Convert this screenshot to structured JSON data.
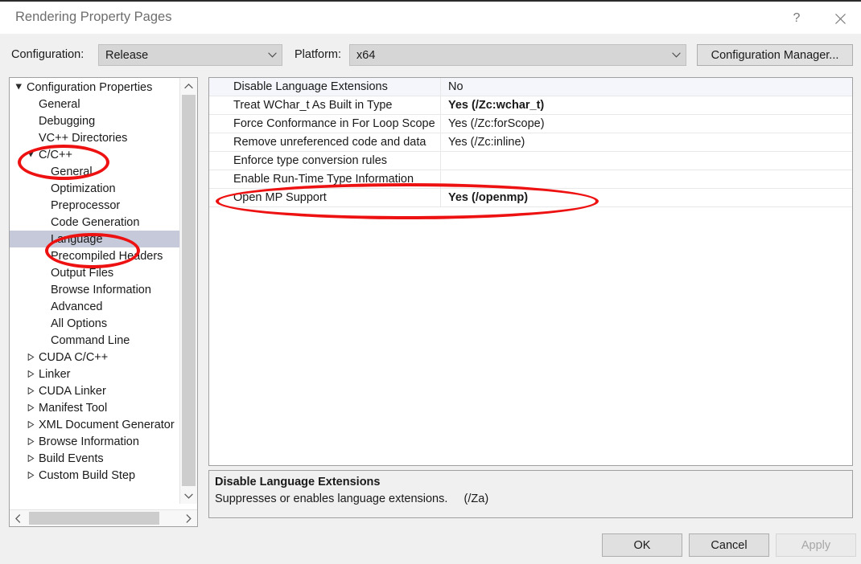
{
  "window": {
    "title": "Rendering Property Pages",
    "help_label": "?",
    "close_label": "Close"
  },
  "toolbar": {
    "configuration_label": "Configuration:",
    "configuration_value": "Release",
    "platform_label": "Platform:",
    "platform_value": "x64",
    "configuration_manager_label": "Configuration Manager..."
  },
  "tree": {
    "nodes": [
      {
        "label": "Configuration Properties",
        "level": 0,
        "state": "expanded",
        "selected": false
      },
      {
        "label": "General",
        "level": 1,
        "state": "leaf",
        "selected": false
      },
      {
        "label": "Debugging",
        "level": 1,
        "state": "leaf",
        "selected": false
      },
      {
        "label": "VC++ Directories",
        "level": 1,
        "state": "leaf",
        "selected": false
      },
      {
        "label": "C/C++",
        "level": 1,
        "state": "expanded",
        "selected": false
      },
      {
        "label": "General",
        "level": 2,
        "state": "leaf",
        "selected": false
      },
      {
        "label": "Optimization",
        "level": 2,
        "state": "leaf",
        "selected": false
      },
      {
        "label": "Preprocessor",
        "level": 2,
        "state": "leaf",
        "selected": false
      },
      {
        "label": "Code Generation",
        "level": 2,
        "state": "leaf",
        "selected": false
      },
      {
        "label": "Language",
        "level": 2,
        "state": "leaf",
        "selected": true
      },
      {
        "label": "Precompiled Headers",
        "level": 2,
        "state": "leaf",
        "selected": false
      },
      {
        "label": "Output Files",
        "level": 2,
        "state": "leaf",
        "selected": false
      },
      {
        "label": "Browse Information",
        "level": 2,
        "state": "leaf",
        "selected": false
      },
      {
        "label": "Advanced",
        "level": 2,
        "state": "leaf",
        "selected": false
      },
      {
        "label": "All Options",
        "level": 2,
        "state": "leaf",
        "selected": false
      },
      {
        "label": "Command Line",
        "level": 2,
        "state": "leaf",
        "selected": false
      },
      {
        "label": "CUDA C/C++",
        "level": 1,
        "state": "collapsed",
        "selected": false
      },
      {
        "label": "Linker",
        "level": 1,
        "state": "collapsed",
        "selected": false
      },
      {
        "label": "CUDA Linker",
        "level": 1,
        "state": "collapsed",
        "selected": false
      },
      {
        "label": "Manifest Tool",
        "level": 1,
        "state": "collapsed",
        "selected": false
      },
      {
        "label": "XML Document Generator",
        "level": 1,
        "state": "collapsed",
        "selected": false
      },
      {
        "label": "Browse Information",
        "level": 1,
        "state": "collapsed",
        "selected": false
      },
      {
        "label": "Build Events",
        "level": 1,
        "state": "collapsed",
        "selected": false
      },
      {
        "label": "Custom Build Step",
        "level": 1,
        "state": "collapsed",
        "selected": false
      }
    ]
  },
  "properties": {
    "rows": [
      {
        "name": "Disable Language Extensions",
        "value": "No",
        "bold": false,
        "highlighted": true
      },
      {
        "name": "Treat WChar_t As Built in Type",
        "value": "Yes (/Zc:wchar_t)",
        "bold": true,
        "highlighted": false
      },
      {
        "name": "Force Conformance in For Loop Scope",
        "value": "Yes (/Zc:forScope)",
        "bold": false,
        "highlighted": false
      },
      {
        "name": "Remove unreferenced code and data",
        "value": "Yes (/Zc:inline)",
        "bold": false,
        "highlighted": false
      },
      {
        "name": "Enforce type conversion rules",
        "value": "",
        "bold": false,
        "highlighted": false
      },
      {
        "name": "Enable Run-Time Type Information",
        "value": "",
        "bold": false,
        "highlighted": false
      },
      {
        "name": "Open MP Support",
        "value": "Yes (/openmp)",
        "bold": true,
        "highlighted": false
      }
    ]
  },
  "description": {
    "title": "Disable Language Extensions",
    "text": "Suppresses or enables language extensions.     (/Za)"
  },
  "buttons": {
    "ok": "OK",
    "cancel": "Cancel",
    "apply": "Apply"
  },
  "annotations": {
    "color": "#ee1111",
    "targets": [
      "C/C++",
      "Language",
      "Open MP Support"
    ]
  }
}
